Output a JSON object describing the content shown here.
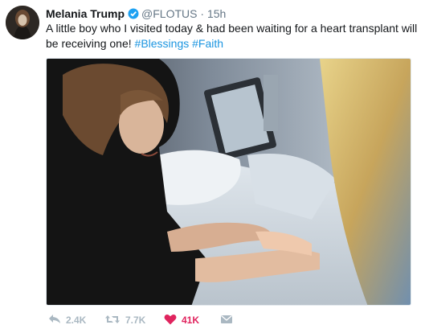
{
  "tweet": {
    "author_name": "Melania Trump",
    "handle": "@FLOTUS",
    "separator": "·",
    "time": "15h",
    "text_main": "A little boy who I visited today & had been waiting for a heart transplant will be receiving one! ",
    "hashtags": [
      "#Blessings",
      "#Faith"
    ],
    "media_icon": "photo"
  },
  "actions": {
    "reply": {
      "icon": "reply-icon",
      "count": "2.4K"
    },
    "retweet": {
      "icon": "retweet-icon",
      "count": "7.7K"
    },
    "like": {
      "icon": "heart-icon",
      "count": "41K",
      "color": "#e0245e"
    },
    "message": {
      "icon": "envelope-icon"
    }
  },
  "colors": {
    "link": "#1b95e0",
    "muted": "#657786",
    "action": "#aab8c2",
    "verified": "#1da1f2"
  }
}
